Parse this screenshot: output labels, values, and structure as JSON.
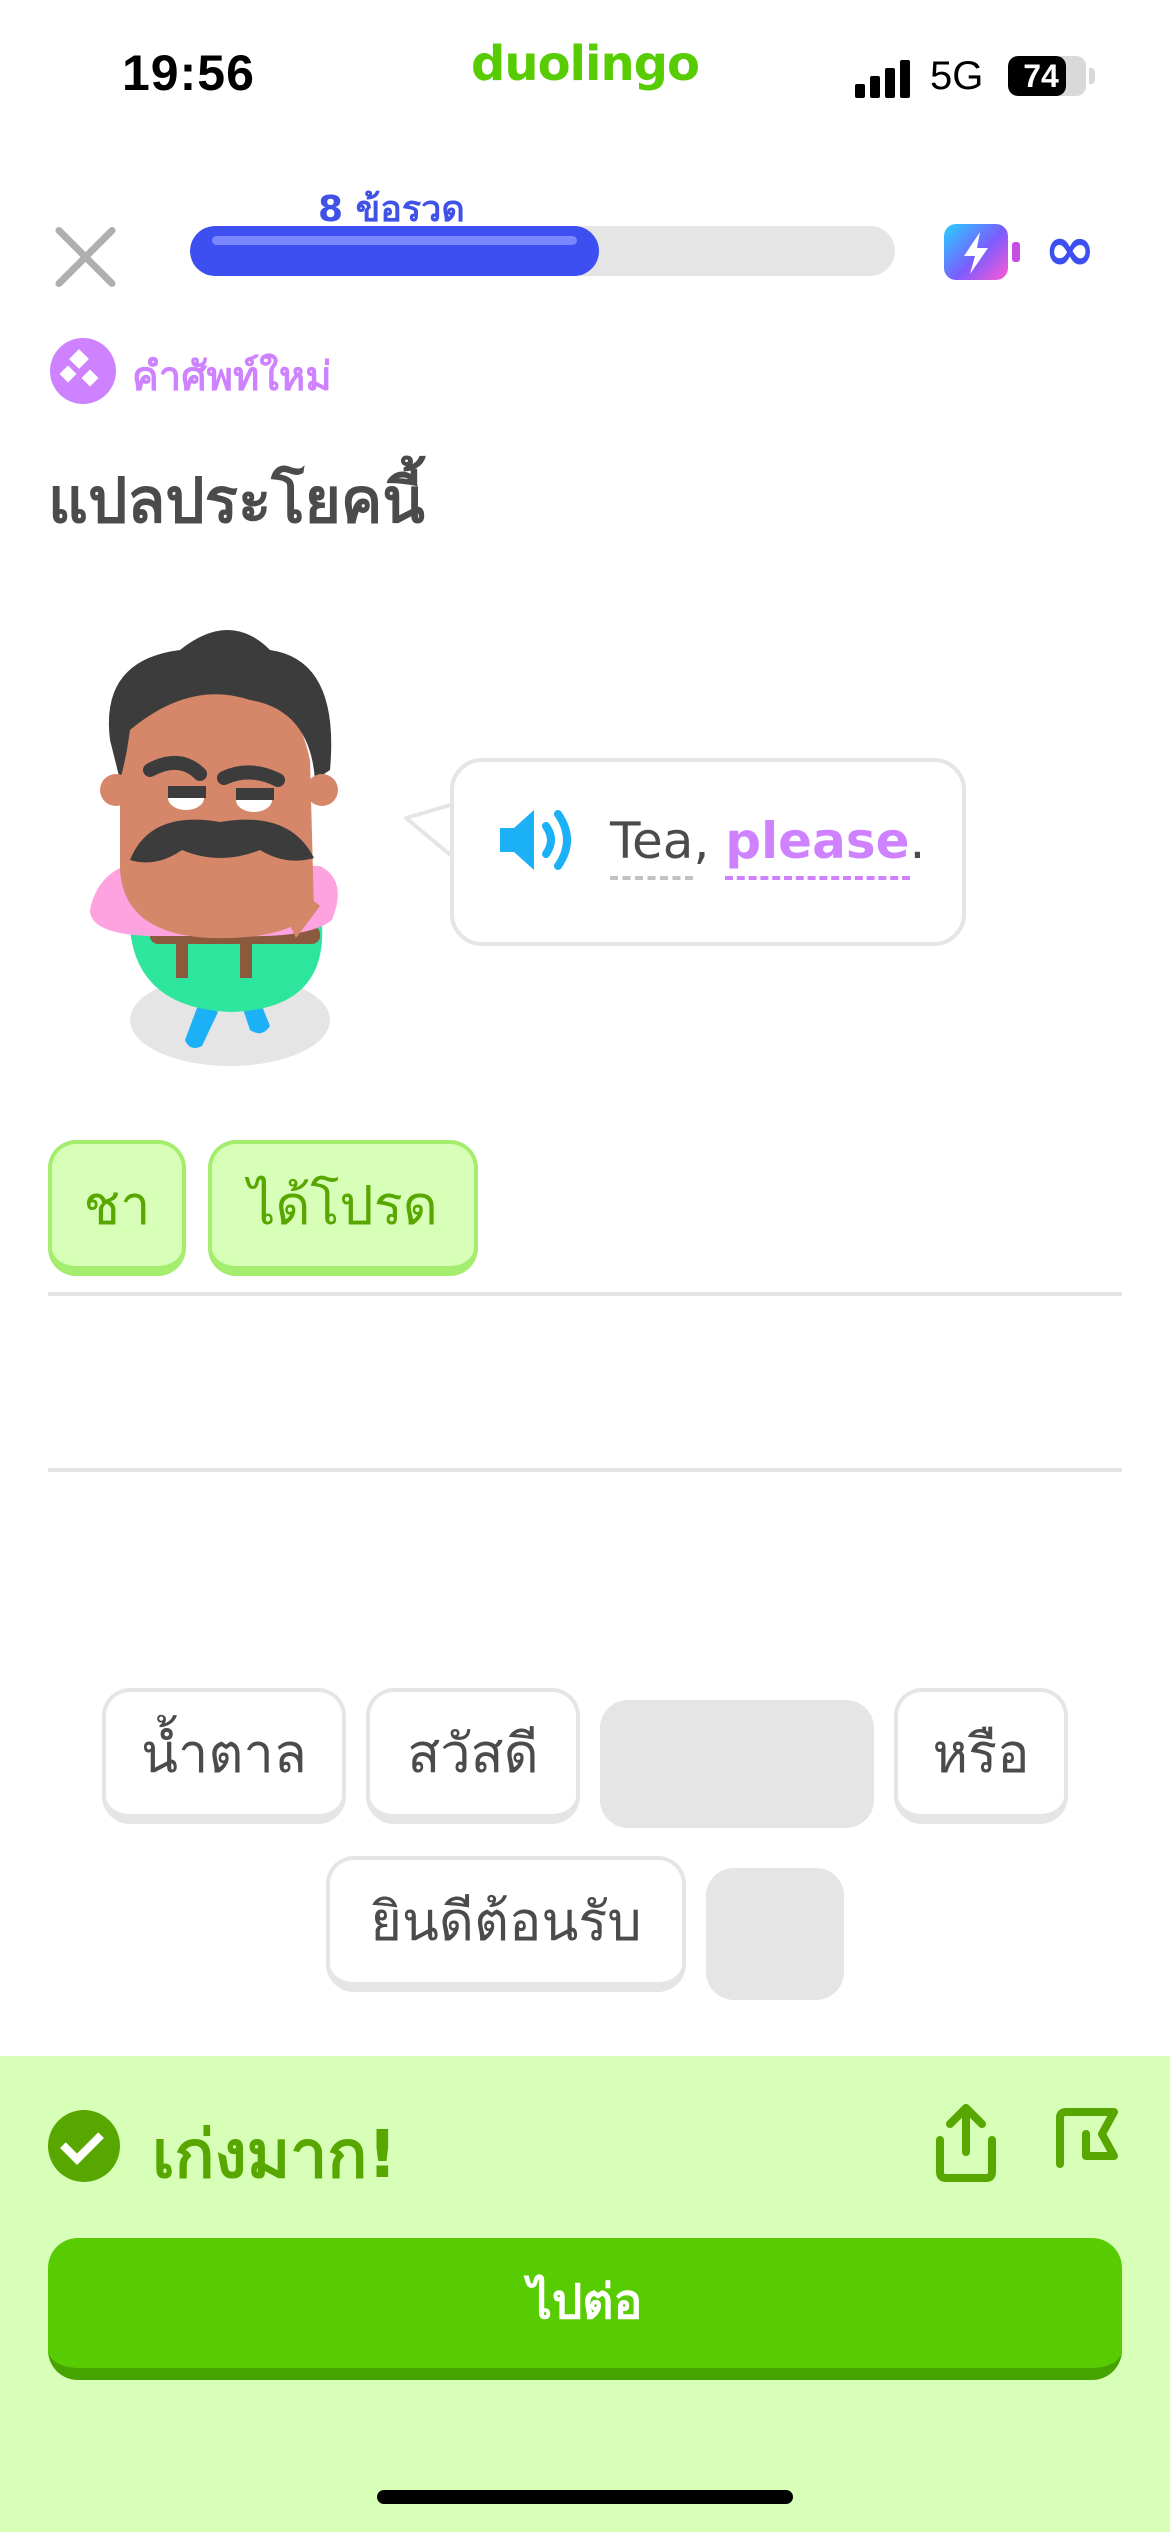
{
  "status_bar": {
    "time": "19:56",
    "app_name": "duolingo",
    "network": "5G",
    "battery": "74",
    "battery_level": 0.74
  },
  "header": {
    "close_icon": "close-icon",
    "streak_label": "8 ข้อรวด",
    "progress": 0.58,
    "energy_icon": "energy-icon",
    "energy_value": "∞"
  },
  "lesson": {
    "tag_icon": "new-word-icon",
    "tag_label": "คำศัพท์ใหม่",
    "title": "แปลประโยคนี้",
    "sentence": {
      "word1": "Tea",
      "comma": ", ",
      "word2": "please",
      "period": "."
    }
  },
  "answer": {
    "selected": [
      "ชา",
      "ได้โปรด"
    ]
  },
  "word_bank": {
    "row1": [
      "น้ำตาล",
      "สวัสดี",
      "",
      "หรือ"
    ],
    "row2": [
      "ยินดีต้อนรับ",
      ""
    ]
  },
  "feedback": {
    "message": "เก่งมาก!",
    "continue_label": "ไปต่อ",
    "colors": {
      "panel": "#d7ffb8",
      "accent": "#58a700",
      "button": "#58cc02"
    }
  }
}
